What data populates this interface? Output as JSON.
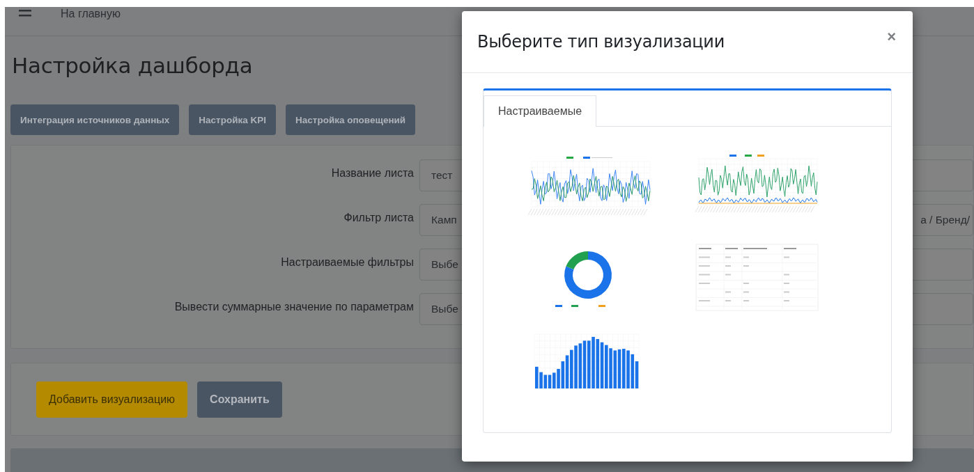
{
  "topbar": {
    "home_link": "На главную"
  },
  "page": {
    "title": "Настройка дашборда",
    "nav_buttons": [
      "Интеграция источников данных",
      "Настройка KPI",
      "Настройка оповещений"
    ],
    "form": [
      {
        "label": "Название листа",
        "value": "тест"
      },
      {
        "label": "Фильтр листа",
        "value": "Камп",
        "value_end": "а / Бренд/"
      },
      {
        "label": "Настраиваемые фильтры",
        "value": "Выбе"
      },
      {
        "label": "Вывести суммарные значение по параметрам",
        "value": "Выбе"
      }
    ],
    "actions": [
      {
        "label": "Добавить визуализацию",
        "kind": "warning"
      },
      {
        "label": "Сохранить",
        "kind": "secondary"
      }
    ]
  },
  "modal": {
    "title": "Выберите тип визуализации",
    "close": "×",
    "tabs": [
      {
        "label": "Настраиваемые",
        "selected": true
      }
    ],
    "visualizations": [
      {
        "kind": "line"
      },
      {
        "kind": "multiline"
      },
      {
        "kind": "donut"
      },
      {
        "kind": "table"
      },
      {
        "kind": "bar"
      }
    ]
  }
}
